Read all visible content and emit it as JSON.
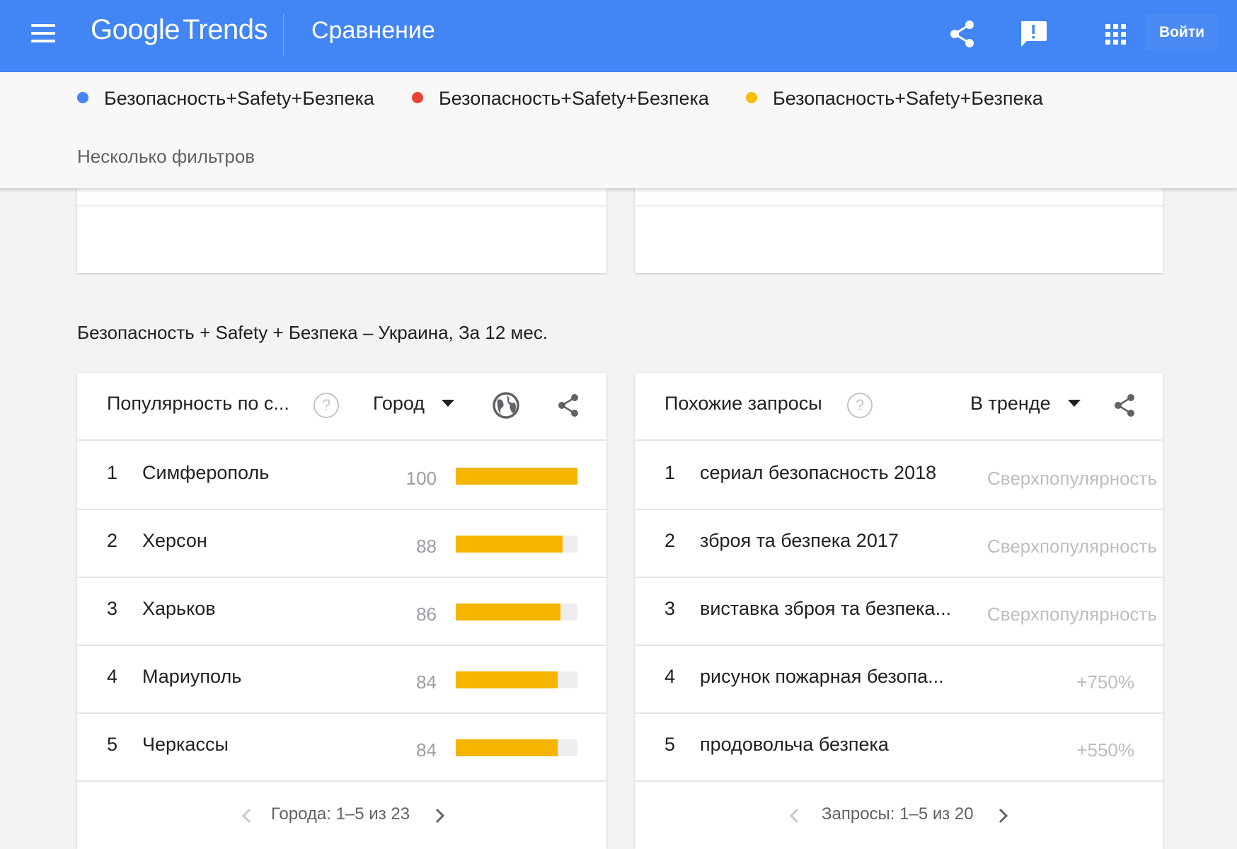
{
  "header": {
    "logo_google": "Google",
    "logo_trends": "Trends",
    "title": "Сравнение",
    "login_label": "Войти",
    "icons": [
      "menu-icon",
      "share-icon",
      "feedback-icon",
      "apps-icon"
    ]
  },
  "compare": {
    "terms": [
      {
        "label": "Безопасность+Safety+Безпека",
        "color": "#4285f4"
      },
      {
        "label": "Безопасность+Safety+Безпека",
        "color": "#ea4335"
      },
      {
        "label": "Безопасность+Safety+Безпека",
        "color": "#fbbc04"
      }
    ],
    "filters_label": "Несколько фильтров"
  },
  "section": {
    "title": "Безопасность + Safety + Безпека – Украина, За 12 мес."
  },
  "regions": {
    "title": "Популярность по с...",
    "help": "?",
    "dropdown": "Город",
    "bar_color": "#f4b400",
    "rows": [
      {
        "rank": "1",
        "name": "Симферополь",
        "value": 100
      },
      {
        "rank": "2",
        "name": "Херсон",
        "value": 88
      },
      {
        "rank": "3",
        "name": "Харьков",
        "value": 86
      },
      {
        "rank": "4",
        "name": "Мариуполь",
        "value": 84
      },
      {
        "rank": "5",
        "name": "Черкассы",
        "value": 84
      }
    ],
    "pager": "Города: 1–5 из 23"
  },
  "queries": {
    "title": "Похожие запросы",
    "help": "?",
    "dropdown": "В тренде",
    "rows": [
      {
        "rank": "1",
        "name": "сериал безопасность 2018",
        "value": "Сверхпопулярность"
      },
      {
        "rank": "2",
        "name": "зброя та безпека 2017",
        "value": "Сверхпопулярность"
      },
      {
        "rank": "3",
        "name": "виставка зброя та безпека...",
        "value": "Сверхпопулярность"
      },
      {
        "rank": "4",
        "name": "рисунок пожарная безопа...",
        "value": "+750%"
      },
      {
        "rank": "5",
        "name": "продовольча безпека",
        "value": "+550%"
      }
    ],
    "pager": "Запросы: 1–5 из 20"
  }
}
